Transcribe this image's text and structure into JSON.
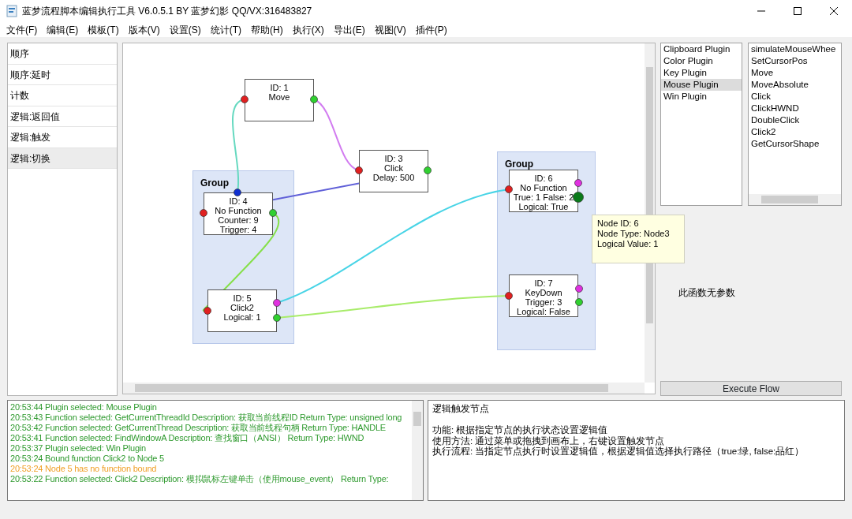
{
  "window": {
    "title": "蓝梦流程脚本编辑执行工具 V6.0.5.1 BY 蓝梦幻影 QQ/VX:316483827"
  },
  "menu": [
    "文件(F)",
    "编辑(E)",
    "模板(T)",
    "版本(V)",
    "设置(S)",
    "统计(T)",
    "帮助(H)",
    "执行(X)",
    "导出(E)",
    "视图(V)",
    "插件(P)"
  ],
  "node_types": [
    {
      "label": "顺序",
      "selected": false
    },
    {
      "label": "顺序:延时",
      "selected": false
    },
    {
      "label": "计数",
      "selected": false
    },
    {
      "label": "逻辑:返回值",
      "selected": false
    },
    {
      "label": "逻辑:触发",
      "selected": false
    },
    {
      "label": "逻辑:切换",
      "selected": true
    }
  ],
  "canvas": {
    "groups": [
      {
        "title": "Group"
      },
      {
        "title": "Group"
      }
    ],
    "nodes": [
      {
        "lines": [
          "ID: 1",
          "Move"
        ]
      },
      {
        "lines": [
          "ID: 3",
          "Click",
          "Delay: 500"
        ]
      },
      {
        "lines": [
          "ID: 4",
          "No Function",
          "Counter: 9",
          "Trigger: 4"
        ]
      },
      {
        "lines": [
          "ID: 5",
          "Click2",
          "Logical: 1"
        ]
      },
      {
        "lines": [
          "ID: 6",
          "No Function",
          "True: 1 False: 2",
          "Logical: True"
        ]
      },
      {
        "lines": [
          "ID: 7",
          "KeyDown",
          "Trigger: 3",
          "Logical: False"
        ]
      }
    ],
    "connections": [
      {
        "color": "#66d9c0"
      },
      {
        "color": "#d27cf0"
      },
      {
        "color": "#6060d8"
      },
      {
        "color": "#86e04a"
      },
      {
        "color": "#48d4e6"
      },
      {
        "color": "#a8ec6a"
      }
    ]
  },
  "tooltip": {
    "lines": [
      "Node ID: 6",
      "Node Type: Node3",
      "Logical Value: 1"
    ]
  },
  "plugins": [
    {
      "label": "Clipboard Plugin",
      "selected": false
    },
    {
      "label": "Color Plugin",
      "selected": false
    },
    {
      "label": "Key Plugin",
      "selected": false
    },
    {
      "label": "Mouse Plugin",
      "selected": true
    },
    {
      "label": "Win Plugin",
      "selected": false
    }
  ],
  "functions": [
    "simulateMouseWhee",
    "SetCursorPos",
    "Move",
    "MoveAbsolute",
    "Click",
    "ClickHWND",
    "DoubleClick",
    "Click2",
    "GetCursorShape"
  ],
  "params_text": "此函数无参数",
  "execute_button": "Execute Flow",
  "log": [
    {
      "kind": "info",
      "text": "20:53:44 Plugin selected: Mouse Plugin"
    },
    {
      "kind": "info",
      "text": "20:53:43 Function selected: GetCurrentThreadId Description: 获取当前线程ID Return Type: unsigned long"
    },
    {
      "kind": "info",
      "text": "20:53:42 Function selected: GetCurrentThread Description: 获取当前线程句柄 Return Type: HANDLE"
    },
    {
      "kind": "info",
      "text": "20:53:41 Function selected: FindWindowA Description: 查找窗口（ANSI） Return Type: HWND"
    },
    {
      "kind": "info",
      "text": "20:53:37 Plugin selected: Win Plugin"
    },
    {
      "kind": "info",
      "text": "20:53:24 Bound function Click2 to Node 5"
    },
    {
      "kind": "warning",
      "text": "20:53:24 Node 5 has no function bound"
    },
    {
      "kind": "info",
      "text": "20:53:22 Function selected: Click2 Description: 模拟鼠标左键单击（使用mouse_event） Return Type:"
    }
  ],
  "description": {
    "title": "逻辑触发节点",
    "lines": [
      "功能: 根据指定节点的执行状态设置逻辑值",
      "使用方法: 通过菜单或拖拽到画布上，右键设置触发节点",
      "执行流程: 当指定节点执行时设置逻辑值，根据逻辑值选择执行路径（true:绿, false:品红）"
    ]
  }
}
